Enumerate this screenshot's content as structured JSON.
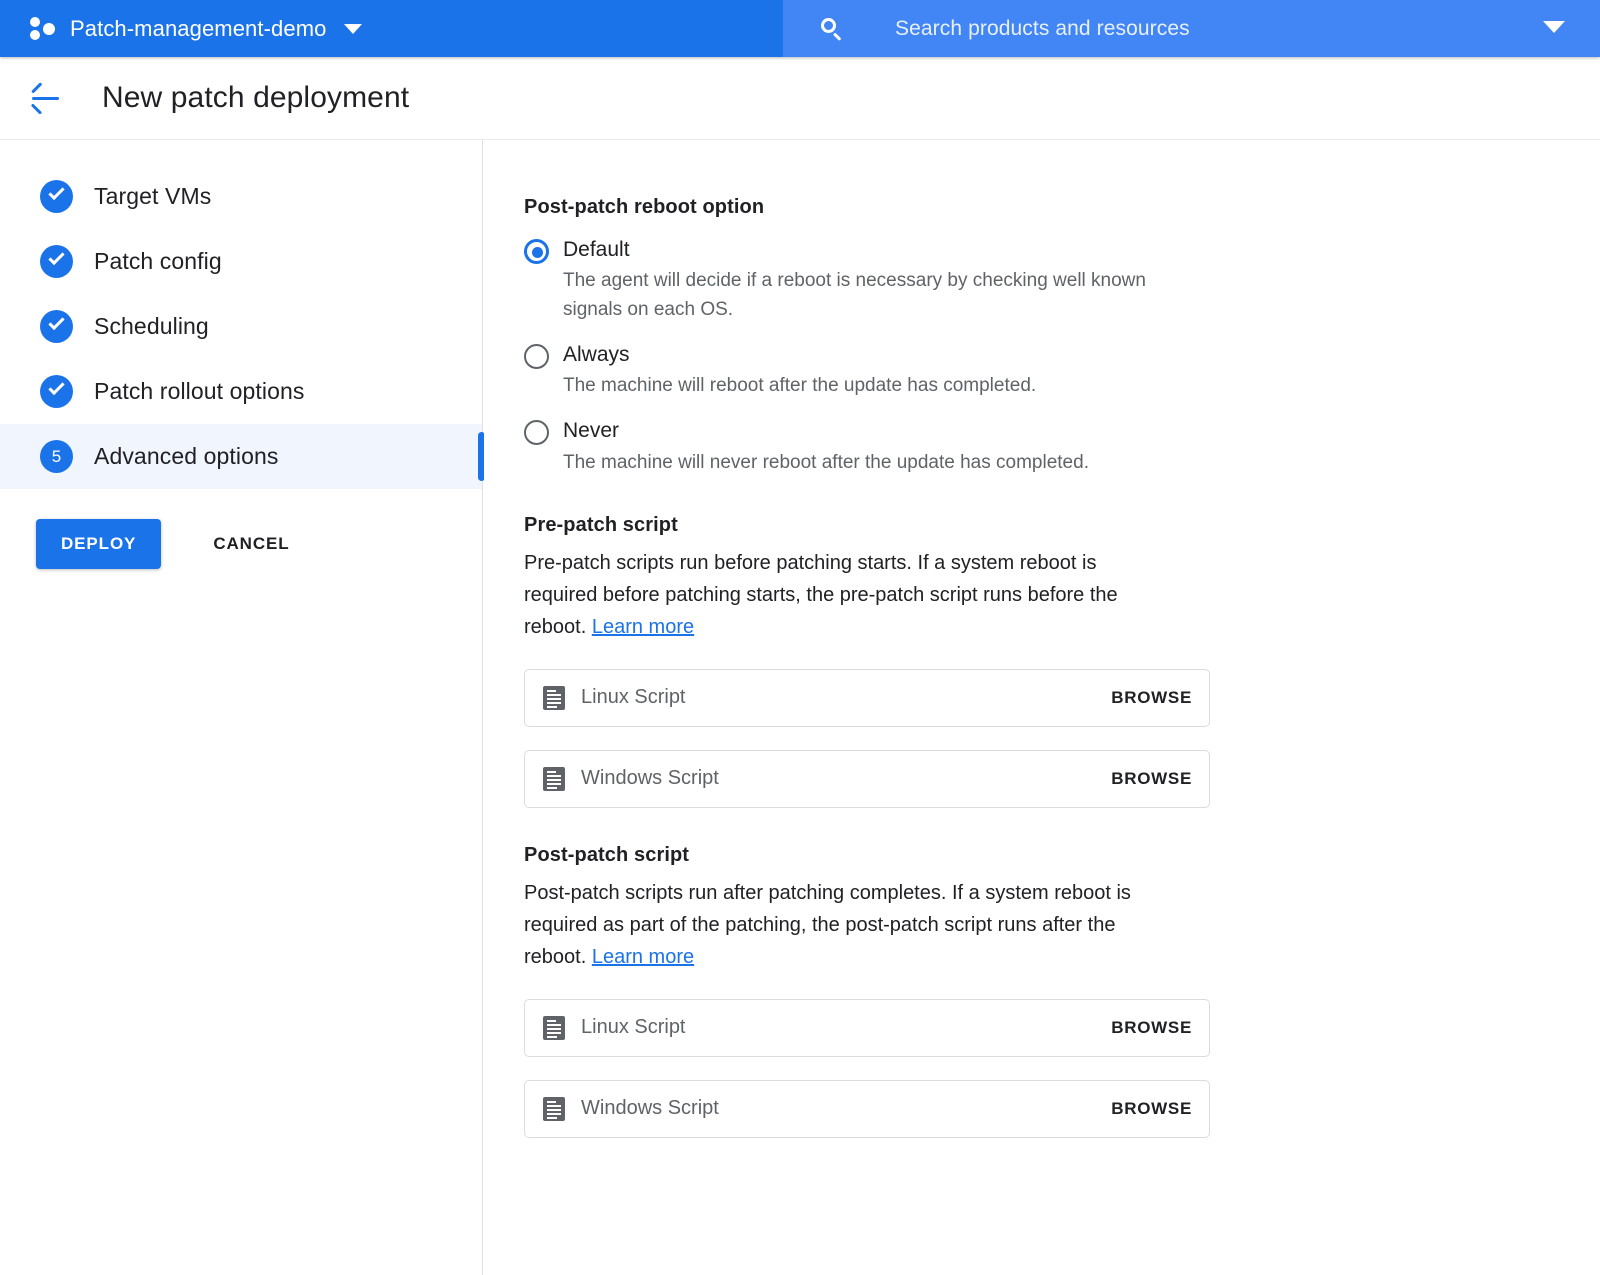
{
  "appbar": {
    "project_name": "Patch-management-demo",
    "search_placeholder": "Search products and resources"
  },
  "titlebar": {
    "title": "New patch deployment"
  },
  "sidebar": {
    "steps": [
      {
        "label": "Target VMs",
        "state": "complete",
        "marker": "check"
      },
      {
        "label": "Patch config",
        "state": "complete",
        "marker": "check"
      },
      {
        "label": "Scheduling",
        "state": "complete",
        "marker": "check"
      },
      {
        "label": "Patch rollout options",
        "state": "complete",
        "marker": "check"
      },
      {
        "label": "Advanced options",
        "state": "active",
        "marker": "5"
      }
    ],
    "deploy_label": "DEPLOY",
    "cancel_label": "CANCEL"
  },
  "reboot": {
    "heading": "Post-patch reboot option",
    "options": [
      {
        "label": "Default",
        "selected": true,
        "description": "The agent will decide if a reboot is necessary by checking well known signals on each OS."
      },
      {
        "label": "Always",
        "selected": false,
        "description": "The machine will reboot after the update has completed."
      },
      {
        "label": "Never",
        "selected": false,
        "description": "The machine will never reboot after the update has completed."
      }
    ]
  },
  "pre_patch": {
    "heading": "Pre-patch script",
    "description": "Pre-patch scripts run before patching starts. If a system reboot is required before patching starts, the pre-patch script runs before the reboot. ",
    "link_label": "Learn more",
    "linux_placeholder": "Linux Script",
    "windows_placeholder": "Windows Script",
    "browse_label": "BROWSE"
  },
  "post_patch": {
    "heading": "Post-patch script",
    "description": "Post-patch scripts run after patching completes. If a system reboot is required as part of the patching, the post-patch script runs after the reboot. ",
    "link_label": "Learn more",
    "linux_placeholder": "Linux Script",
    "windows_placeholder": "Windows Script",
    "browse_label": "BROWSE"
  },
  "colors": {
    "brand_blue": "#1a73e8",
    "appbar_blue": "#1a73e8",
    "search_blue": "#4285f4",
    "active_row": "#f1f5fe",
    "text_primary": "#202124",
    "text_secondary": "#5f6368",
    "border": "#dadce0"
  }
}
